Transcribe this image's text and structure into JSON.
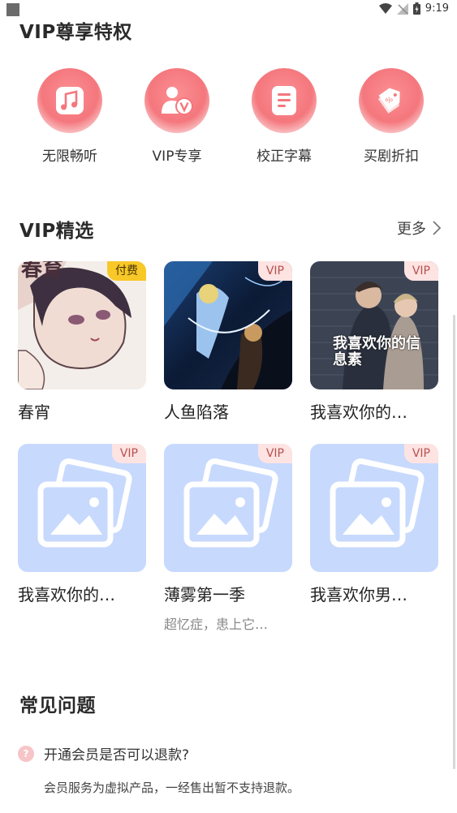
{
  "status_bar": {
    "time": "9:19"
  },
  "privileges": {
    "title": "VIP尊享特权",
    "items": [
      {
        "label": "无限畅听",
        "icon": "music-note-icon"
      },
      {
        "label": "VIP专享",
        "icon": "vip-user-icon"
      },
      {
        "label": "校正字幕",
        "icon": "subtitle-doc-icon"
      },
      {
        "label": "买剧折扣",
        "icon": "discount-tag-icon"
      }
    ]
  },
  "picks": {
    "title": "VIP精选",
    "more": "更多",
    "items": [
      {
        "title": "春宵",
        "badge": "付费",
        "subtitle": ""
      },
      {
        "title": "人鱼陷落",
        "badge": "VIP",
        "subtitle": ""
      },
      {
        "title": "我喜欢你的…",
        "badge": "VIP",
        "subtitle": "",
        "cover_text": "我喜欢你的信息素"
      },
      {
        "title": "我喜欢你的…",
        "badge": "VIP",
        "subtitle": ""
      },
      {
        "title": "薄雾第一季",
        "badge": "VIP",
        "subtitle": "超忆症，患上它…"
      },
      {
        "title": "我喜欢你男…",
        "badge": "VIP",
        "subtitle": ""
      }
    ]
  },
  "faq": {
    "title": "常见问题",
    "items": [
      {
        "question": "开通会员是否可以退款?",
        "answer": "会员服务为虚拟产品，一经售出暂不支持退款。"
      }
    ]
  },
  "colors": {
    "accent_pink": "#f4777d",
    "vip_badge_bg": "#fde3e2",
    "paid_badge_bg": "#f7c827",
    "placeholder_blue": "#c7d9fd"
  }
}
